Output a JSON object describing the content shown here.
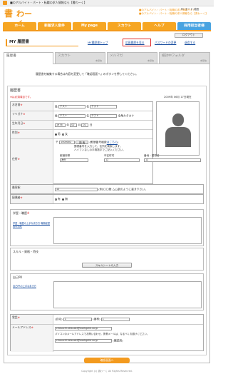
{
  "browser": {
    "title": "■のアルバイト・パート・転職の求人情報なら【書わーく】"
  },
  "header": {
    "logo_kanji": "書",
    "logo_kana": "わーく",
    "tagline1": "■のアルバイト・パート・転職の求人情報サイト",
    "tagline2": "■のアルバイト・パート・転職の求人情報なら【書わーく】",
    "help_links": "PC モード 地図"
  },
  "nav": [
    "ホーム",
    "新着求人案件",
    "My page",
    "スカウト",
    "ヘルプ",
    "採用担当者様"
  ],
  "logout_label": "ログアウト",
  "page_title": "MY 履歴書",
  "top_links": [
    "MY履歴書トップ",
    "応募履歴を見る",
    "パスワードの変更",
    "退会する"
  ],
  "tabs": [
    {
      "label": "履歴書",
      "sub": ""
    },
    {
      "label": "スカウト",
      "sub": "未受信"
    },
    {
      "label": "メルマガ",
      "sub": "未受信"
    },
    {
      "label": "検討中フォルダ",
      "sub": "未受信"
    }
  ],
  "intro": "履歴書を編集する場合は内容を変更して「確認画面へ」のボタンを押してください。",
  "resume": {
    "heading": "履歴書",
    "required_note": "※は必須項目です。",
    "date": "2009年 06月 17日現在",
    "name": {
      "label": "お名前",
      "sei_label": "姓",
      "sei": "テスト",
      "mei_label": "名",
      "mei": "テスト"
    },
    "kana": {
      "label": "フリガナ",
      "sei_label": "姓",
      "sei": "テスト",
      "mei_label": "名",
      "mei": "テスト",
      "note": "全角カタカナ"
    },
    "birth": {
      "label": "生年月日",
      "year": "1976",
      "y_unit": "年",
      "month": "02",
      "m_unit": "月",
      "day": "01",
      "d_unit": "日"
    },
    "gender": {
      "label": "性別",
      "male": "男",
      "female": "女"
    },
    "address": {
      "label": "住所",
      "zip_mark": "〒",
      "zip": "1500002",
      "search_label": "検 索",
      "zip_hint": "(郵便番号検索",
      "zip_hint_link": "はこちら",
      "zip_hint_end": ")",
      "note1": "郵便番号を入力して、住所を検索します。",
      "note2": "ハイフンなしの半角数字でご記入ください。",
      "pref_label": "都道府県",
      "pref": "海外",
      "city_label": "市区町村",
      "city": "12",
      "street_label": "番地・建物名",
      "street": "12"
    },
    "station": {
      "label": "最寄駅",
      "value": "12",
      "note": "(例)〇〇線 ムム駅のように書き下さい。"
    },
    "spouse": {
      "label": "配偶者",
      "yes": "有",
      "no": "無"
    },
    "education": {
      "label": "学歴・職歴",
      "sub_link": "学歴・職歴の上手な書き方 職務経歴書の作成"
    },
    "skills": {
      "label": "スキル・資格・特技",
      "button": "スキルシートの入力"
    },
    "pr": {
      "label": "自己PR",
      "sub_link": "自己PRの上手な書き方"
    },
    "phone": {
      "label": "電話",
      "home_label": "(自宅)",
      "home": "1",
      "mobile_label": "(携帯)",
      "mobile": "1"
    },
    "email": {
      "label": "メールアドレス",
      "pc": "chasuchi.tatsuaki@workgate.co.jp",
      "pc_note": "パソコンのメールアドレスでお問い合わせ。携帯メールは、なるべくお避けください。",
      "mobile": "chasuchi.tatsuaki@workgate.co.jp",
      "mobile_note": "(確認用)"
    }
  },
  "confirm_button": "確認画面へ",
  "footer": "Copyright (c) 書わーく All Rights Reserved."
}
